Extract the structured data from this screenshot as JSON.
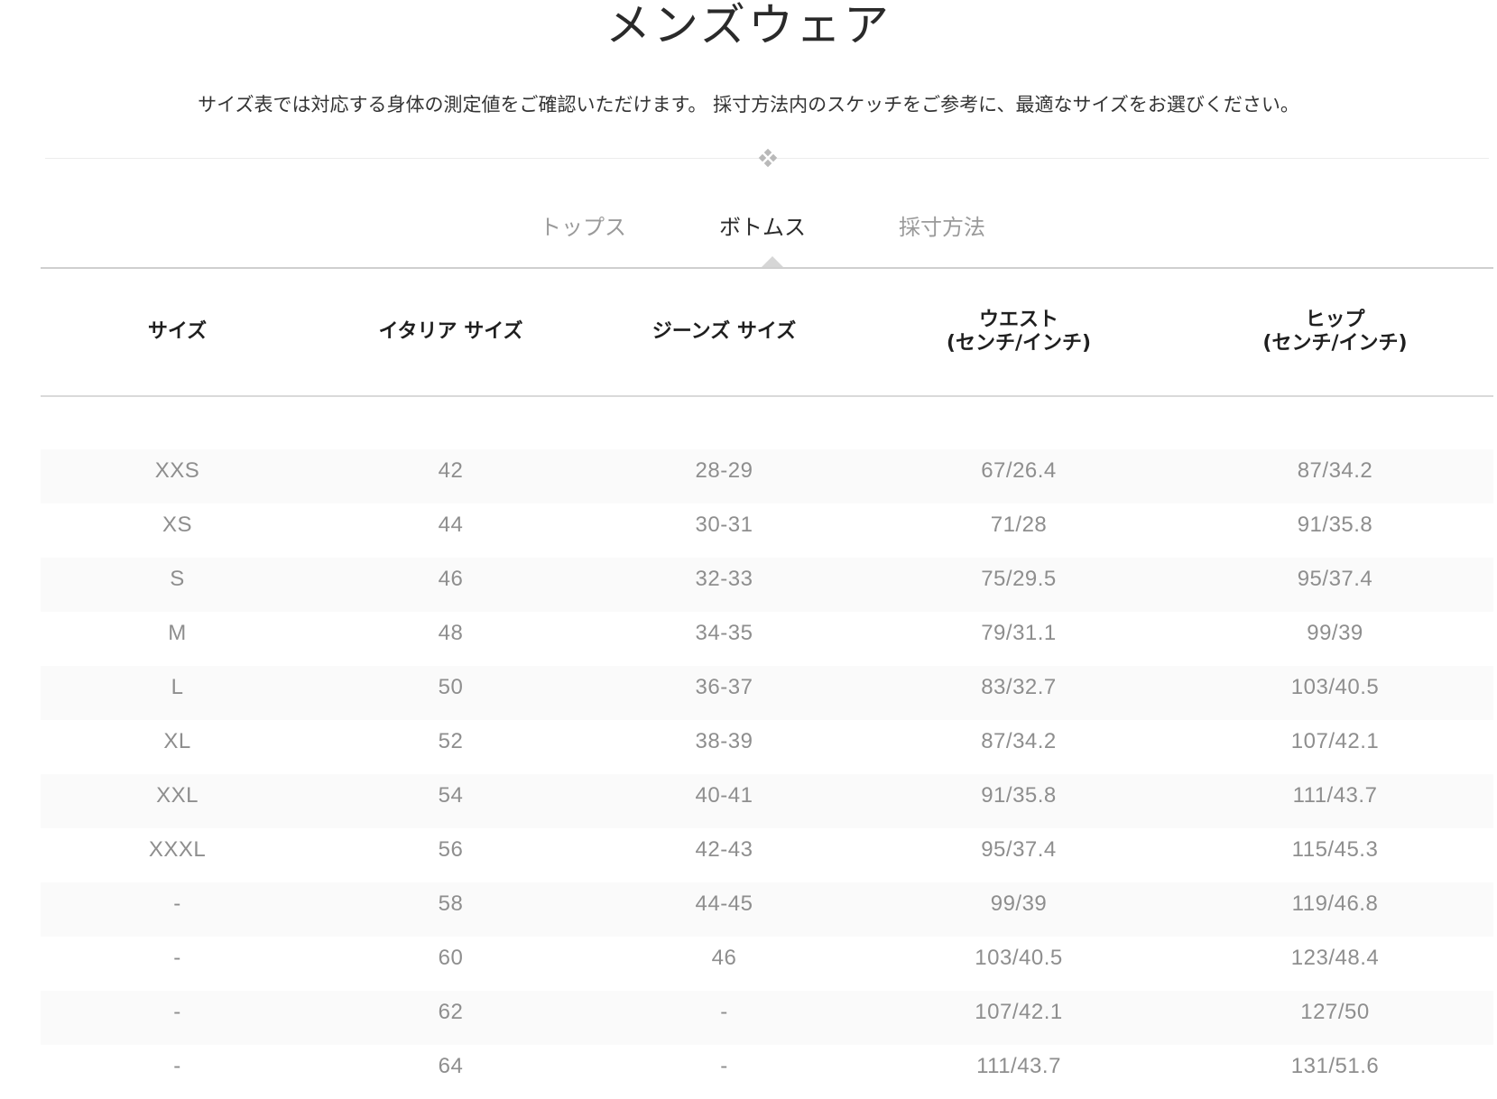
{
  "page": {
    "title": "メンズウェア",
    "subtitle": "サイズ表では対応する身体の測定値をご確認いただけます。 採寸方法内のスケッチをご参考に、最適なサイズをお選びください。"
  },
  "tabs": [
    {
      "label": "トップス",
      "active": false
    },
    {
      "label": "ボトムス",
      "active": true
    },
    {
      "label": "採寸方法",
      "active": false
    }
  ],
  "table": {
    "headers": [
      "サイズ",
      "イタリア サイズ",
      "ジーンズ サイズ",
      "ウエスト\n(センチ/インチ)",
      "ヒップ\n(センチ/インチ)"
    ],
    "rows": [
      [
        "XXS",
        "42",
        "28-29",
        "67/26.4",
        "87/34.2"
      ],
      [
        "XS",
        "44",
        "30-31",
        "71/28",
        "91/35.8"
      ],
      [
        "S",
        "46",
        "32-33",
        "75/29.5",
        "95/37.4"
      ],
      [
        "M",
        "48",
        "34-35",
        "79/31.1",
        "99/39"
      ],
      [
        "L",
        "50",
        "36-37",
        "83/32.7",
        "103/40.5"
      ],
      [
        "XL",
        "52",
        "38-39",
        "87/34.2",
        "107/42.1"
      ],
      [
        "XXL",
        "54",
        "40-41",
        "91/35.8",
        "111/43.7"
      ],
      [
        "XXXL",
        "56",
        "42-43",
        "95/37.4",
        "115/45.3"
      ],
      [
        "-",
        "58",
        "44-45",
        "99/39",
        "119/46.8"
      ],
      [
        "-",
        "60",
        "46",
        "103/40.5",
        "123/48.4"
      ],
      [
        "-",
        "62",
        "-",
        "107/42.1",
        "127/50"
      ],
      [
        "-",
        "64",
        "-",
        "111/43.7",
        "131/51.6"
      ]
    ]
  },
  "colors": {
    "active_tab": "#2a2a2a",
    "inactive_tab": "#9a9a9a",
    "cell_text": "#8e8e8e",
    "row_stripe": "#fafafa"
  },
  "icons": {
    "divider": "diamond-ornament-icon",
    "tab_indicator": "caret-up-icon"
  }
}
